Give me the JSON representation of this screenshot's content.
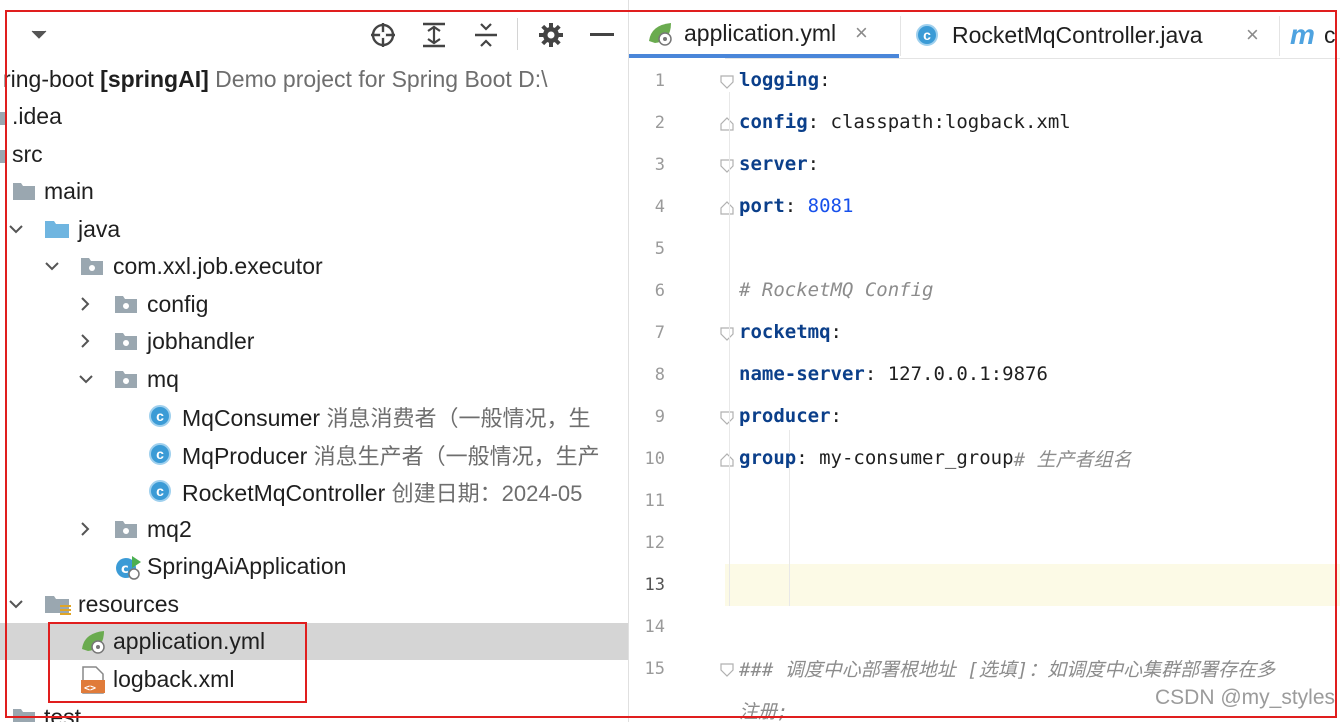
{
  "toolbar": {
    "icons": [
      "chevron-down-icon",
      "crosshair-icon",
      "expand-all-icon",
      "collapse-all-icon",
      "gear-icon",
      "minus-icon"
    ]
  },
  "project": {
    "root": {
      "name": "ring-boot",
      "module": "[springAI]",
      "description": "Demo project for Spring Boot",
      "path": "D:\\"
    },
    "tree": {
      "idea": ".idea",
      "src": "src",
      "main": "main",
      "java": "java",
      "package": "com.xxl.job.executor",
      "config": "config",
      "jobhandler": "jobhandler",
      "mq": "mq",
      "mq_consumer": {
        "name": "MqConsumer",
        "desc": "消息消费者（一般情况，生"
      },
      "mq_producer": {
        "name": "MqProducer",
        "desc": "消息生产者（一般情况，生产"
      },
      "rocket_controller": {
        "name": "RocketMqController",
        "desc": "创建日期：2024-05"
      },
      "mq2": "mq2",
      "spring_app": "SpringAiApplication",
      "resources": "resources",
      "application_yml": "application.yml",
      "logback_xml": "logback.xml",
      "test": "test"
    }
  },
  "editor": {
    "tabs": [
      {
        "label": "application.yml",
        "active": true
      },
      {
        "label": "RocketMqController.java",
        "active": false
      },
      {
        "label": "m",
        "active": false
      }
    ],
    "close_glyph": "×",
    "lines": {
      "l1_key": "logging",
      "l2_key": "config",
      "l2_val": "classpath:logback.xml",
      "l3_key": "server",
      "l4_key": "port",
      "l4_val": "8081",
      "l6_comment": "# RocketMQ Config",
      "l7_key": "rocketmq",
      "l8_key": "name-server",
      "l8_val": "127.0.0.1:9876",
      "l9_key": "producer",
      "l10_key": "group",
      "l10_val": "my-consumer_group",
      "l10_comment": "# 生产者组名",
      "l15_comment": "### 调度中心部署根地址 [选填]：如调度中心集群部署存在多",
      "l16_comment": "注册;"
    },
    "line_numbers": [
      "1",
      "2",
      "3",
      "4",
      "5",
      "6",
      "7",
      "8",
      "9",
      "10",
      "11",
      "12",
      "13",
      "14",
      "15"
    ],
    "current_line": "13"
  },
  "watermark": "CSDN @my_styles",
  "colors": {
    "highlight": "#e01e1e",
    "tab_underline": "#4a86d9",
    "key": "#0b3f8a",
    "number": "#1750eb",
    "comment": "#8c8c8c"
  }
}
